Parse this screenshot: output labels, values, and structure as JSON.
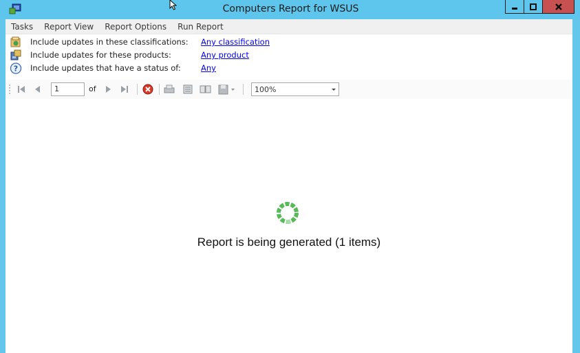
{
  "window": {
    "title": "Computers Report for WSUS"
  },
  "menu": [
    "Tasks",
    "Report View",
    "Report Options",
    "Run Report"
  ],
  "filters": [
    {
      "label": "Include updates in these classifications:",
      "link": "Any classification",
      "icon": "classification-icon"
    },
    {
      "label": "Include updates for these products:",
      "link": "Any product",
      "icon": "products-icon"
    },
    {
      "label": "Include updates that have a status of:",
      "link": "Any",
      "icon": "help-icon"
    }
  ],
  "toolbar": {
    "page": "1",
    "of_label": "of",
    "zoom": "100%"
  },
  "report": {
    "status": "Report is being generated (1 items)"
  },
  "colors": {
    "titlebar": "#5ec6ec",
    "close": "#c75050",
    "link": "#0000ee",
    "spinner": "#4caf50"
  }
}
